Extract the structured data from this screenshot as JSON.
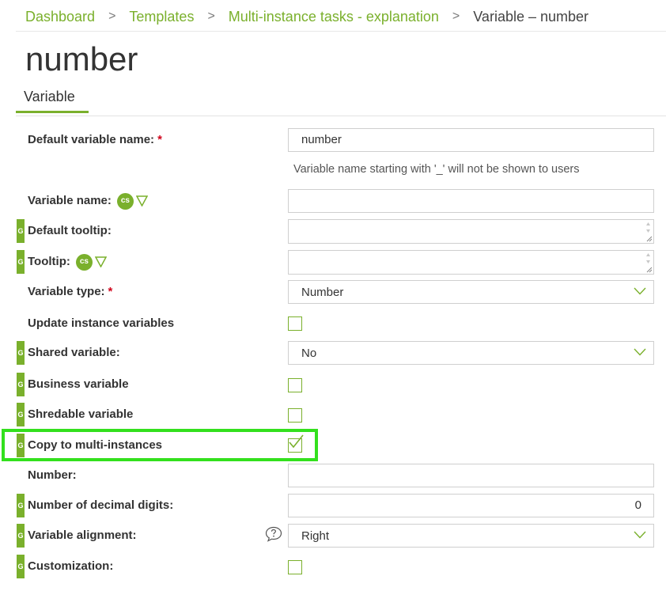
{
  "breadcrumb": {
    "items": [
      "Dashboard",
      "Templates",
      "Multi-instance tasks - explanation"
    ],
    "current": "Variable – number",
    "separator": ">"
  },
  "page": {
    "title": "number",
    "tab": "Variable"
  },
  "form": {
    "default_variable_name": {
      "label": "Default variable name:",
      "required": "*",
      "value": "number",
      "hint": "Variable name starting with '_' will not be shown to users"
    },
    "variable_name": {
      "label": "Variable name:",
      "badge": "cs",
      "value": ""
    },
    "default_tooltip": {
      "badge": "G",
      "label": "Default tooltip:",
      "value": ""
    },
    "tooltip": {
      "badge": "G",
      "label": "Tooltip:",
      "cs_badge": "cs",
      "value": ""
    },
    "variable_type": {
      "label": "Variable type:",
      "required": "*",
      "value": "Number"
    },
    "update_instance_variables": {
      "label": "Update instance variables",
      "checked": false
    },
    "shared_variable": {
      "badge": "G",
      "label": "Shared variable:",
      "value": "No"
    },
    "business_variable": {
      "badge": "G",
      "label": "Business variable",
      "checked": false
    },
    "shredable_variable": {
      "badge": "G",
      "label": "Shredable variable",
      "checked": false
    },
    "copy_to_multi_instances": {
      "badge": "G",
      "label": "Copy to multi-instances",
      "checked": true
    },
    "number": {
      "label": "Number:",
      "value": ""
    },
    "number_of_decimal_digits": {
      "badge": "G",
      "label": "Number of decimal digits:",
      "value": "0"
    },
    "variable_alignment": {
      "badge": "G",
      "label": "Variable alignment:",
      "value": "Right"
    },
    "customization": {
      "badge": "G",
      "label": "Customization:",
      "checked": false
    }
  },
  "colors": {
    "accent": "#7ab02c",
    "highlight": "#33e01d",
    "required": "#d0021b"
  },
  "icons": {
    "filter": "filter-icon",
    "select_arrow": "chevron-down-icon",
    "help": "help-bubble-icon",
    "check": "checkmark-icon"
  }
}
